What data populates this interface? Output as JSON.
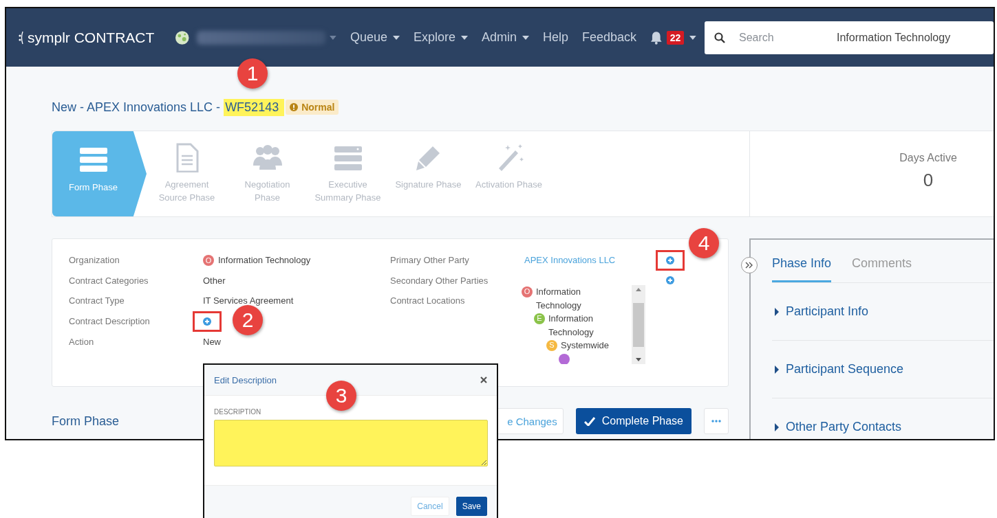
{
  "navbar": {
    "logo": "symplr CONTRACT",
    "menus": [
      {
        "label": "Queue",
        "dropdown": true
      },
      {
        "label": "Explore",
        "dropdown": true
      },
      {
        "label": "Admin",
        "dropdown": true
      },
      {
        "label": "Help",
        "dropdown": false
      },
      {
        "label": "Feedback",
        "dropdown": false
      }
    ],
    "notification_count": "22",
    "search": {
      "placeholder": "Search",
      "scope": "Information Technology"
    }
  },
  "header": {
    "title": "New - APEX Innovations LLC - ",
    "workflow_id": "WF52143",
    "id_highlighted": true,
    "priority": "Normal"
  },
  "phases": [
    {
      "label": "Form Phase",
      "selected": true
    },
    {
      "label": "Agreement Source Phase",
      "selected": false
    },
    {
      "label": "Negotiation Phase",
      "selected": false
    },
    {
      "label": "Executive Summary Phase",
      "selected": false
    },
    {
      "label": "Signature Phase",
      "selected": false
    },
    {
      "label": "Activation Phase",
      "selected": false
    }
  ],
  "days_active": {
    "label": "Days Active",
    "value": "0"
  },
  "details": {
    "left": [
      {
        "label": "Organization",
        "kind": "badge",
        "badge": "O",
        "color": "#e57373",
        "value": "Information Technology"
      },
      {
        "label": "Contract Categories",
        "kind": "text",
        "value": "Other"
      },
      {
        "label": "Contract Type",
        "kind": "text",
        "value": "IT Services Agreement"
      },
      {
        "label": "Contract Description",
        "kind": "add",
        "highlighted": true
      },
      {
        "label": "Action",
        "kind": "text",
        "value": "New"
      }
    ],
    "right": [
      {
        "label": "Primary Other Party",
        "kind": "link",
        "value": "APEX Innovations LLC",
        "add_highlighted": true
      },
      {
        "label": "Secondary Other Parties",
        "kind": "empty",
        "add_highlighted": false
      },
      {
        "label": "Contract Locations",
        "kind": "tree"
      }
    ],
    "locations": [
      {
        "badge": "O",
        "color": "#e57373",
        "label": "Information Technology",
        "children": [
          {
            "badge": "E",
            "color": "#8bc34a",
            "label": "Information Technology",
            "children": [
              {
                "badge": "S",
                "color": "#f5b942",
                "label": "Systemwide",
                "children": [
                  {
                    "color": "#b36ad6"
                  }
                ]
              }
            ]
          }
        ]
      }
    ]
  },
  "footer": {
    "title": "Form Phase",
    "buttons": [
      {
        "kind": "outline",
        "label": "e Changes"
      },
      {
        "kind": "primary",
        "label": "Complete Phase"
      },
      {
        "kind": "more"
      }
    ]
  },
  "right_panel": {
    "tabs": [
      {
        "label": "Phase Info",
        "selected": true
      },
      {
        "label": "Comments",
        "selected": false
      }
    ],
    "sections": [
      {
        "label": "Participant Info",
        "expanded": false
      },
      {
        "label": "Participant Sequence",
        "expanded": false
      },
      {
        "label": "Other Party Contacts",
        "expanded": false
      }
    ]
  },
  "popup": {
    "title": "Edit Description",
    "field_label": "DESCRIPTION",
    "field_highlighted": true,
    "buttons": [
      {
        "kind": "cancel",
        "label": "Cancel"
      },
      {
        "kind": "save",
        "label": "Save"
      }
    ]
  },
  "annotations": [
    {
      "label": "1"
    },
    {
      "label": "2"
    },
    {
      "label": "3"
    },
    {
      "label": "4"
    }
  ]
}
